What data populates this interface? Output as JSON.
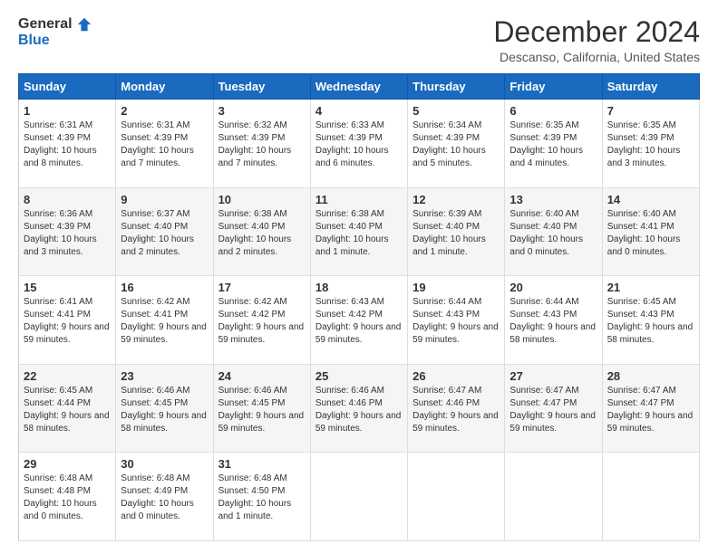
{
  "logo": {
    "general": "General",
    "blue": "Blue"
  },
  "header": {
    "title": "December 2024",
    "subtitle": "Descanso, California, United States"
  },
  "weekdays": [
    "Sunday",
    "Monday",
    "Tuesday",
    "Wednesday",
    "Thursday",
    "Friday",
    "Saturday"
  ],
  "weeks": [
    [
      {
        "day": "1",
        "sunrise": "6:31 AM",
        "sunset": "4:39 PM",
        "daylight": "10 hours and 8 minutes."
      },
      {
        "day": "2",
        "sunrise": "6:31 AM",
        "sunset": "4:39 PM",
        "daylight": "10 hours and 7 minutes."
      },
      {
        "day": "3",
        "sunrise": "6:32 AM",
        "sunset": "4:39 PM",
        "daylight": "10 hours and 7 minutes."
      },
      {
        "day": "4",
        "sunrise": "6:33 AM",
        "sunset": "4:39 PM",
        "daylight": "10 hours and 6 minutes."
      },
      {
        "day": "5",
        "sunrise": "6:34 AM",
        "sunset": "4:39 PM",
        "daylight": "10 hours and 5 minutes."
      },
      {
        "day": "6",
        "sunrise": "6:35 AM",
        "sunset": "4:39 PM",
        "daylight": "10 hours and 4 minutes."
      },
      {
        "day": "7",
        "sunrise": "6:35 AM",
        "sunset": "4:39 PM",
        "daylight": "10 hours and 3 minutes."
      }
    ],
    [
      {
        "day": "8",
        "sunrise": "6:36 AM",
        "sunset": "4:39 PM",
        "daylight": "10 hours and 3 minutes."
      },
      {
        "day": "9",
        "sunrise": "6:37 AM",
        "sunset": "4:40 PM",
        "daylight": "10 hours and 2 minutes."
      },
      {
        "day": "10",
        "sunrise": "6:38 AM",
        "sunset": "4:40 PM",
        "daylight": "10 hours and 2 minutes."
      },
      {
        "day": "11",
        "sunrise": "6:38 AM",
        "sunset": "4:40 PM",
        "daylight": "10 hours and 1 minute."
      },
      {
        "day": "12",
        "sunrise": "6:39 AM",
        "sunset": "4:40 PM",
        "daylight": "10 hours and 1 minute."
      },
      {
        "day": "13",
        "sunrise": "6:40 AM",
        "sunset": "4:40 PM",
        "daylight": "10 hours and 0 minutes."
      },
      {
        "day": "14",
        "sunrise": "6:40 AM",
        "sunset": "4:41 PM",
        "daylight": "10 hours and 0 minutes."
      }
    ],
    [
      {
        "day": "15",
        "sunrise": "6:41 AM",
        "sunset": "4:41 PM",
        "daylight": "9 hours and 59 minutes."
      },
      {
        "day": "16",
        "sunrise": "6:42 AM",
        "sunset": "4:41 PM",
        "daylight": "9 hours and 59 minutes."
      },
      {
        "day": "17",
        "sunrise": "6:42 AM",
        "sunset": "4:42 PM",
        "daylight": "9 hours and 59 minutes."
      },
      {
        "day": "18",
        "sunrise": "6:43 AM",
        "sunset": "4:42 PM",
        "daylight": "9 hours and 59 minutes."
      },
      {
        "day": "19",
        "sunrise": "6:44 AM",
        "sunset": "4:43 PM",
        "daylight": "9 hours and 59 minutes."
      },
      {
        "day": "20",
        "sunrise": "6:44 AM",
        "sunset": "4:43 PM",
        "daylight": "9 hours and 58 minutes."
      },
      {
        "day": "21",
        "sunrise": "6:45 AM",
        "sunset": "4:43 PM",
        "daylight": "9 hours and 58 minutes."
      }
    ],
    [
      {
        "day": "22",
        "sunrise": "6:45 AM",
        "sunset": "4:44 PM",
        "daylight": "9 hours and 58 minutes."
      },
      {
        "day": "23",
        "sunrise": "6:46 AM",
        "sunset": "4:45 PM",
        "daylight": "9 hours and 58 minutes."
      },
      {
        "day": "24",
        "sunrise": "6:46 AM",
        "sunset": "4:45 PM",
        "daylight": "9 hours and 59 minutes."
      },
      {
        "day": "25",
        "sunrise": "6:46 AM",
        "sunset": "4:46 PM",
        "daylight": "9 hours and 59 minutes."
      },
      {
        "day": "26",
        "sunrise": "6:47 AM",
        "sunset": "4:46 PM",
        "daylight": "9 hours and 59 minutes."
      },
      {
        "day": "27",
        "sunrise": "6:47 AM",
        "sunset": "4:47 PM",
        "daylight": "9 hours and 59 minutes."
      },
      {
        "day": "28",
        "sunrise": "6:47 AM",
        "sunset": "4:47 PM",
        "daylight": "9 hours and 59 minutes."
      }
    ],
    [
      {
        "day": "29",
        "sunrise": "6:48 AM",
        "sunset": "4:48 PM",
        "daylight": "10 hours and 0 minutes."
      },
      {
        "day": "30",
        "sunrise": "6:48 AM",
        "sunset": "4:49 PM",
        "daylight": "10 hours and 0 minutes."
      },
      {
        "day": "31",
        "sunrise": "6:48 AM",
        "sunset": "4:50 PM",
        "daylight": "10 hours and 1 minute."
      },
      null,
      null,
      null,
      null
    ]
  ],
  "labels": {
    "sunrise": "Sunrise:",
    "sunset": "Sunset:",
    "daylight": "Daylight:"
  }
}
